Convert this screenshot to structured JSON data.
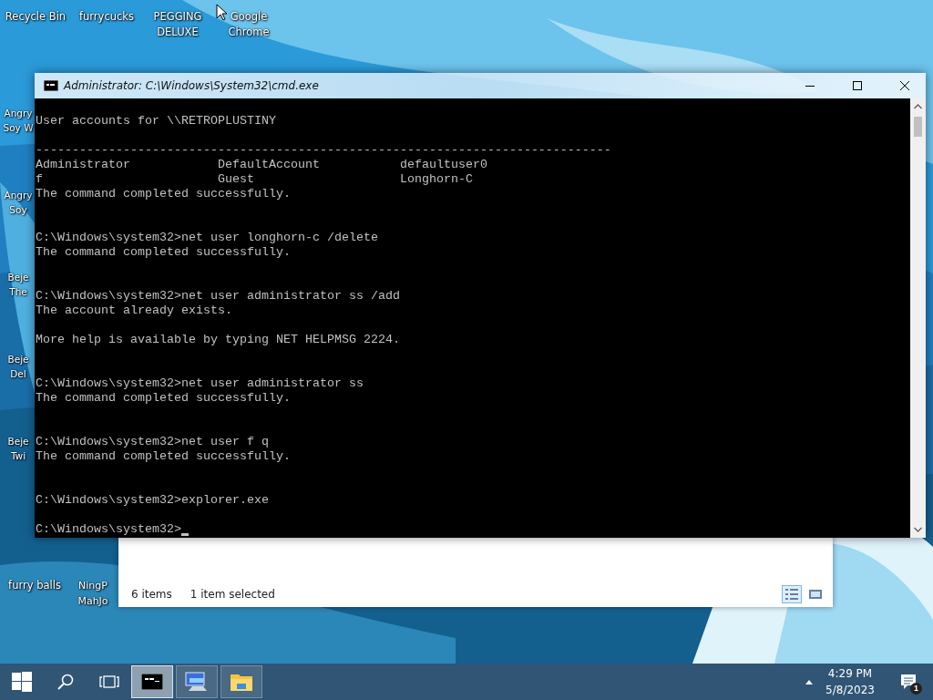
{
  "desktop": {
    "top_icons": [
      {
        "label": "Recycle Bin"
      },
      {
        "label": "furrycucks"
      },
      {
        "label": "PEGGING DELUXE"
      },
      {
        "label": "Google Chrome"
      }
    ],
    "left_icons": [
      {
        "label": "Angry Soy W"
      },
      {
        "label": "Angry Soy"
      },
      {
        "label": "Beje The"
      },
      {
        "label": "Beje Del"
      },
      {
        "label": "Beje Twi"
      }
    ],
    "bottom_icons": [
      {
        "label": "furry balls"
      },
      {
        "label": "NingP MahJo"
      }
    ]
  },
  "explorer": {
    "status_items": "6 items",
    "status_selected": "1 item selected",
    "views": [
      {
        "kind": "details",
        "selected": true
      },
      {
        "kind": "large",
        "selected": false
      }
    ]
  },
  "cmd": {
    "title": "Administrator: C:\\Windows\\System32\\cmd.exe",
    "lines": [
      {
        "kind": "text",
        "text": "User accounts for \\\\RETROPLUSTINY"
      },
      {
        "kind": "blank"
      },
      {
        "kind": "text",
        "text": "-------------------------------------------------------------------------------"
      },
      {
        "kind": "text",
        "text": "Administrator            DefaultAccount           defaultuser0"
      },
      {
        "kind": "text",
        "text": "f                        Guest                    Longhorn-C"
      },
      {
        "kind": "text",
        "text": "The command completed successfully."
      },
      {
        "kind": "blank"
      },
      {
        "kind": "blank"
      },
      {
        "kind": "text",
        "text": "C:\\Windows\\system32>net user longhorn-c /delete"
      },
      {
        "kind": "text",
        "text": "The command completed successfully."
      },
      {
        "kind": "blank"
      },
      {
        "kind": "blank"
      },
      {
        "kind": "text",
        "text": "C:\\Windows\\system32>net user administrator ss /add"
      },
      {
        "kind": "text",
        "text": "The account already exists."
      },
      {
        "kind": "blank"
      },
      {
        "kind": "text",
        "text": "More help is available by typing NET HELPMSG 2224."
      },
      {
        "kind": "blank"
      },
      {
        "kind": "blank"
      },
      {
        "kind": "text",
        "text": "C:\\Windows\\system32>net user administrator ss"
      },
      {
        "kind": "text",
        "text": "The command completed successfully."
      },
      {
        "kind": "blank"
      },
      {
        "kind": "blank"
      },
      {
        "kind": "text",
        "text": "C:\\Windows\\system32>net user f q"
      },
      {
        "kind": "text",
        "text": "The command completed successfully."
      },
      {
        "kind": "blank"
      },
      {
        "kind": "blank"
      },
      {
        "kind": "text",
        "text": "C:\\Windows\\system32>explorer.exe"
      },
      {
        "kind": "blank"
      },
      {
        "kind": "prompt",
        "text": "C:\\Windows\\system32>"
      }
    ]
  },
  "taskbar": {
    "apps": [
      {
        "kind": "cmd",
        "selected": true
      },
      {
        "kind": "computer",
        "selected": false
      },
      {
        "kind": "folder",
        "selected": false
      }
    ],
    "time": "4:29 PM",
    "date": "5/8/2023",
    "notifications": "1"
  }
}
